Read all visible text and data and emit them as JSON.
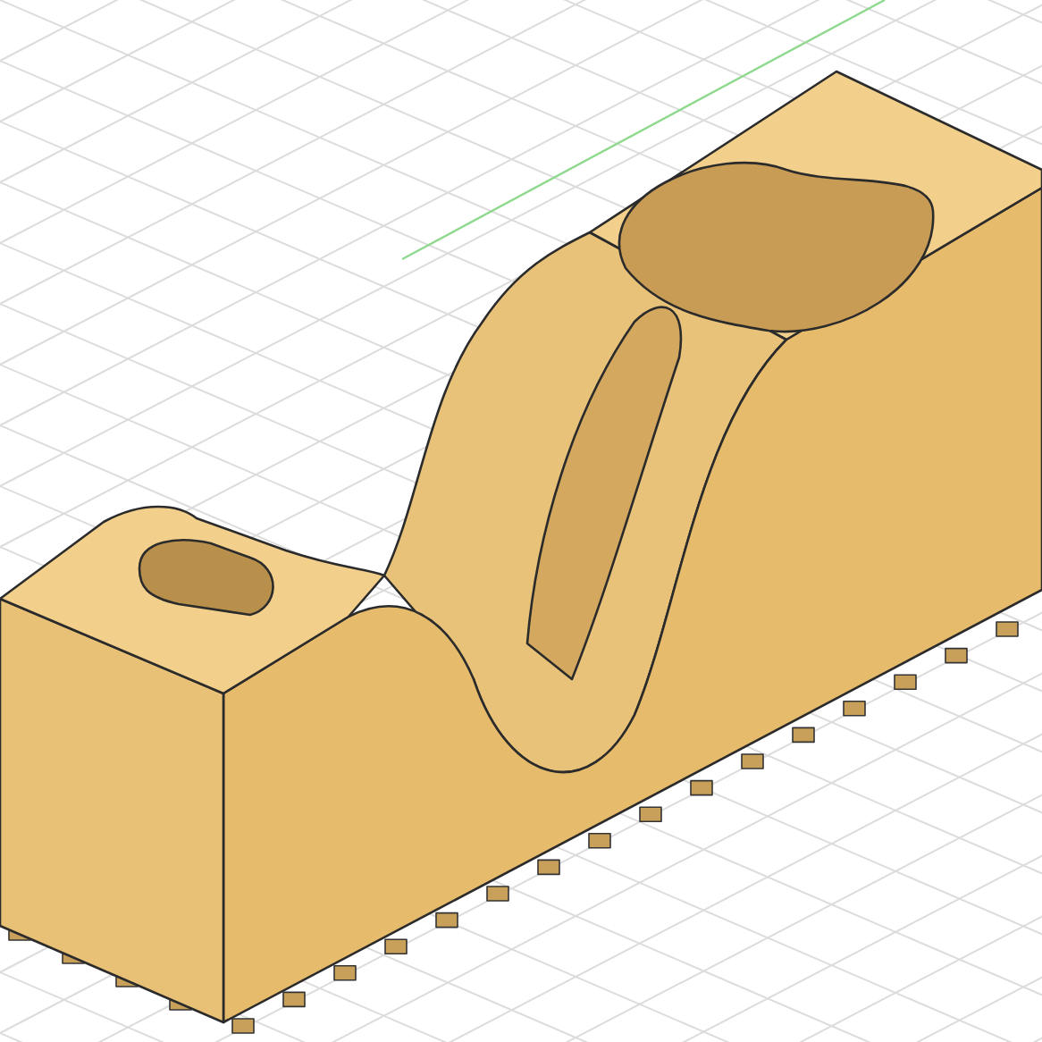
{
  "viewport": {
    "grid": true,
    "axis": true
  }
}
